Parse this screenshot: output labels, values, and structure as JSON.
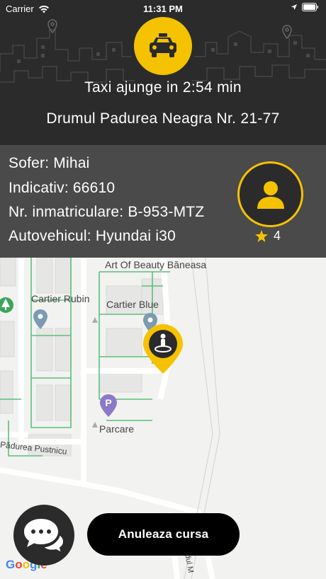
{
  "status_bar": {
    "carrier": "Carrier",
    "time": "11:31 PM"
  },
  "header": {
    "eta": "Taxi ajunge in 2:54 min",
    "address": "Drumul Padurea Neagra Nr. 21-77",
    "icon": "taxi-car-icon",
    "accent_color": "#f5c200"
  },
  "driver": {
    "name_line": "Sofer: Mihai",
    "callsign_line": "Indicativ: 66610",
    "plate_line": "Nr. inmatriculare: B-953-MTZ",
    "vehicle_line": "Autovehicul: Hyundai i30",
    "rating": "4",
    "avatar_icon": "user-icon",
    "star_icon": "star-icon"
  },
  "map": {
    "labels": {
      "art_of_beauty": "Art Of Beauty Băneasa",
      "cartier_rubin": "Cartier Rubin",
      "cartier_blue": "Cartier Blue",
      "parcare": "Parcare",
      "padurea_pustnicu": "Pădurea Pustnicu",
      "padul_m": "padul M"
    },
    "google": "Google"
  },
  "actions": {
    "cancel_label": "Anuleaza cursa",
    "chat_icon": "chat-bubbles-icon"
  }
}
